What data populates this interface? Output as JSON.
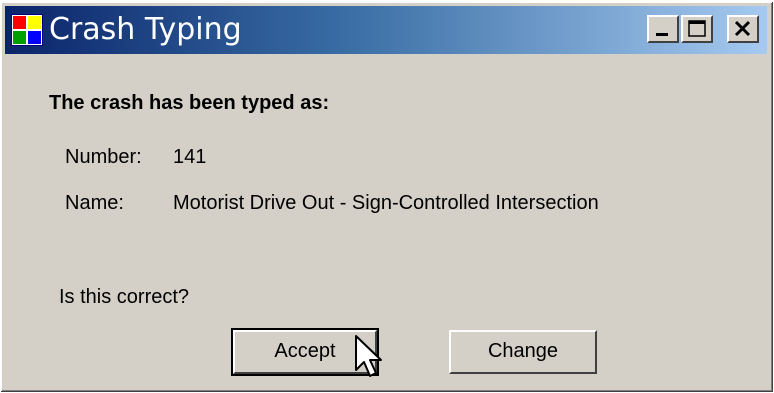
{
  "window": {
    "title": "Crash Typing",
    "controls": {
      "minimize": "minimize-icon",
      "maximize": "maximize-icon",
      "close": "close-icon"
    }
  },
  "dialog": {
    "heading": "The crash has been typed as:",
    "number_label": "Number:",
    "number_value": "141",
    "name_label": "Name:",
    "name_value": "Motorist Drive Out - Sign-Controlled Intersection",
    "question": "Is this correct?"
  },
  "buttons": {
    "accept": "Accept",
    "change": "Change"
  },
  "colors": {
    "title_gradient_start": "#0a246a",
    "title_gradient_end": "#a6caf0",
    "face": "#d4d0c8"
  }
}
